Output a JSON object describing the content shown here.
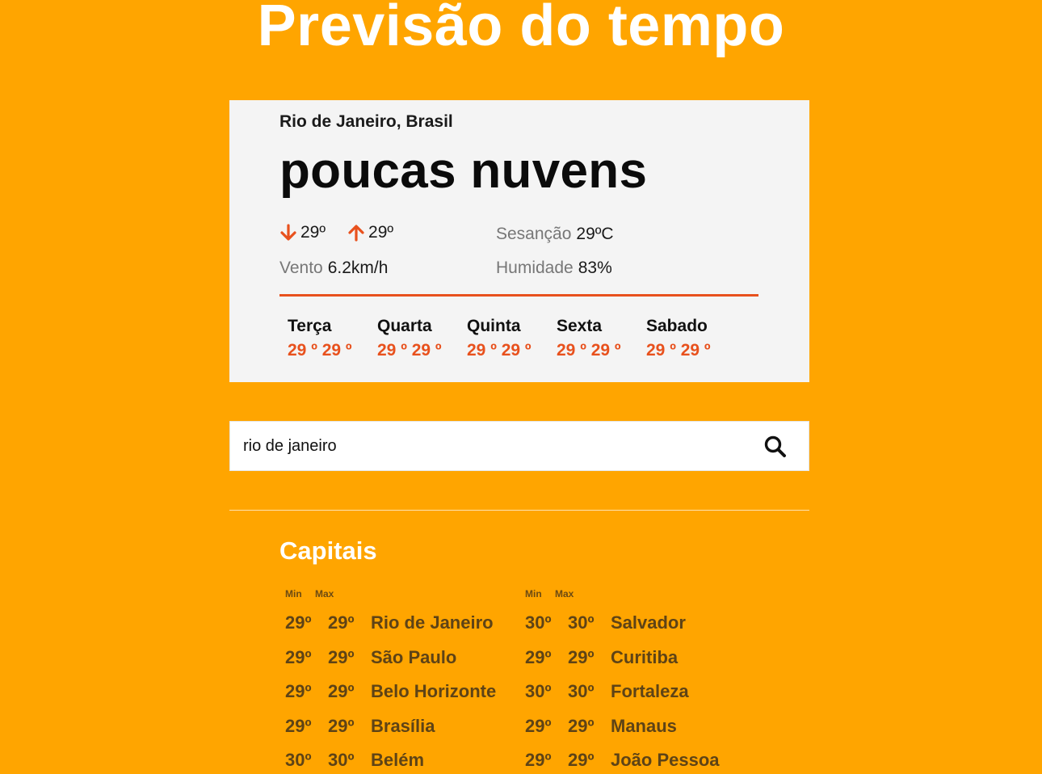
{
  "page": {
    "title": "Previsão do tempo"
  },
  "current": {
    "location": "Rio de Janeiro, Brasil",
    "condition": "poucas nuvens",
    "temp_min": "29º",
    "temp_max": "29º",
    "feels_label": "Sesanção",
    "feels_value": "29ºC",
    "wind_label": "Vento",
    "wind_value": "6.2km/h",
    "humidity_label": "Humidade",
    "humidity_value": "83%"
  },
  "forecast": [
    {
      "day": "Terça",
      "temps": "29 º 29 º"
    },
    {
      "day": "Quarta",
      "temps": "29 º 29 º"
    },
    {
      "day": "Quinta",
      "temps": "29 º 29 º"
    },
    {
      "day": "Sexta",
      "temps": "29 º 29 º"
    },
    {
      "day": "Sabado",
      "temps": "29 º 29 º"
    }
  ],
  "search": {
    "value": "rio de janeiro",
    "icon": "search-icon"
  },
  "capitals": {
    "title": "Capitais",
    "min_label": "Min",
    "max_label": "Max",
    "left": [
      {
        "min": "29º",
        "max": "29º",
        "city": "Rio de Janeiro"
      },
      {
        "min": "29º",
        "max": "29º",
        "city": "São Paulo"
      },
      {
        "min": "29º",
        "max": "29º",
        "city": "Belo Horizonte"
      },
      {
        "min": "29º",
        "max": "29º",
        "city": "Brasília"
      },
      {
        "min": "30º",
        "max": "30º",
        "city": "Belém"
      }
    ],
    "right": [
      {
        "min": "30º",
        "max": "30º",
        "city": "Salvador"
      },
      {
        "min": "29º",
        "max": "29º",
        "city": "Curitiba"
      },
      {
        "min": "30º",
        "max": "30º",
        "city": "Fortaleza"
      },
      {
        "min": "29º",
        "max": "29º",
        "city": "Manaus"
      },
      {
        "min": "29º",
        "max": "29º",
        "city": "João Pessoa"
      }
    ]
  },
  "colors": {
    "background": "#ffa500",
    "accent": "#e8511d",
    "card": "#f4f4f4"
  }
}
